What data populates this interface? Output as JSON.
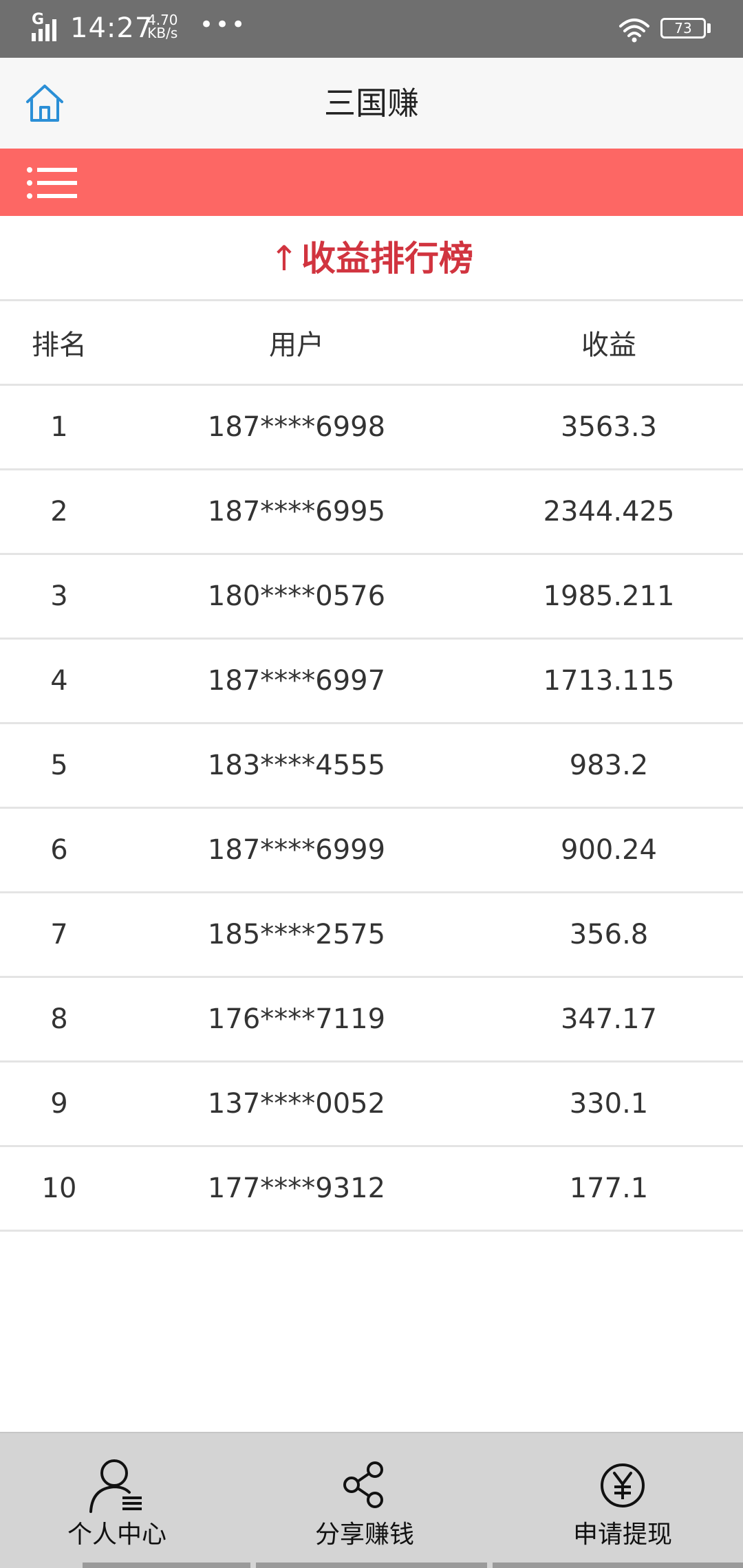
{
  "status_bar": {
    "network": "G",
    "time": "14:27",
    "speed_value": "4.70",
    "speed_unit": "KB/s",
    "more": "•••",
    "battery": "73"
  },
  "header": {
    "title": "三国赚",
    "home_icon": "home-icon"
  },
  "menubar": {
    "menu_icon": "list-menu-icon",
    "color": "#fd6764"
  },
  "section": {
    "arrow": "↑",
    "title": "收益排行榜",
    "color": "#d1343f"
  },
  "table": {
    "headers": [
      "排名",
      "用户",
      "收益"
    ],
    "rows": [
      {
        "rank": "1",
        "user": "187****6998",
        "earnings": "3563.3"
      },
      {
        "rank": "2",
        "user": "187****6995",
        "earnings": "2344.425"
      },
      {
        "rank": "3",
        "user": "180****0576",
        "earnings": "1985.211"
      },
      {
        "rank": "4",
        "user": "187****6997",
        "earnings": "1713.115"
      },
      {
        "rank": "5",
        "user": "183****4555",
        "earnings": "983.2"
      },
      {
        "rank": "6",
        "user": "187****6999",
        "earnings": "900.24"
      },
      {
        "rank": "7",
        "user": "185****2575",
        "earnings": "356.8"
      },
      {
        "rank": "8",
        "user": "176****7119",
        "earnings": "347.17"
      },
      {
        "rank": "9",
        "user": "137****0052",
        "earnings": "330.1"
      },
      {
        "rank": "10",
        "user": "177****9312",
        "earnings": "177.1"
      }
    ]
  },
  "bottom_nav": {
    "items": [
      {
        "label": "个人中心",
        "icon": "user-center-icon"
      },
      {
        "label": "分享赚钱",
        "icon": "share-icon"
      },
      {
        "label": "申请提现",
        "icon": "yen-icon"
      }
    ]
  }
}
